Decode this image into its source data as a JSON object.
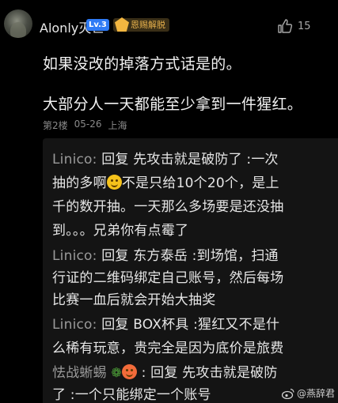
{
  "comment": {
    "username": "Alonly灭世",
    "level_badge": "Lv.3",
    "medal_text": "恩赐解脱",
    "like_count": "15",
    "lines": [
      "如果没改的掉落方式话是的。",
      "大部分人一天都能至少拿到一件猩红。"
    ],
    "floor": "第2楼",
    "date": "05-26",
    "location": "上海"
  },
  "replies": [
    {
      "author": "Linico:",
      "line1": "回复 先攻击就是破防了 :一次",
      "line2a": "抽的多啊",
      "line2b": "不是只给10个20个，是上",
      "line3": "千的数开抽。一天那么多场要是还没抽",
      "line4": "到。。。兄弟你有点霉了"
    },
    {
      "author": "Linico:",
      "line1": "回复 东方泰岳 :到场馆，扫通",
      "line2": "行证的二维码绑定自己账号，然后每场",
      "line3": "比赛一血后就会开始大抽奖"
    },
    {
      "author": "Linico:",
      "line1": "回复 BOX杯具 :猩红又不是什",
      "line2": "么稀有玩意，贵完全是因为底价是旅费"
    },
    {
      "author": "怯战蜥蜴",
      "line1": ": 回复 先攻击就是破防",
      "line2": "了 :一个只能绑定一个账号"
    }
  ],
  "watermark": "@燕辞君",
  "icons": {
    "like": "thumb-up-icon",
    "medal": "medal-icon",
    "weibo": "weibo-icon"
  }
}
